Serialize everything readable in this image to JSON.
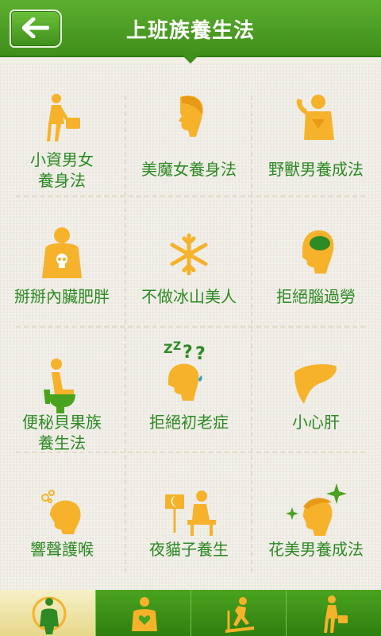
{
  "header": {
    "title": "上班族養生法",
    "back_label": "back"
  },
  "grid": {
    "items": [
      {
        "label": "小資男女\n養身法",
        "icon": "businessman-icon"
      },
      {
        "label": "美魔女養身法",
        "icon": "woman-head-icon"
      },
      {
        "label": "野獸男養成法",
        "icon": "muscle-man-icon"
      },
      {
        "label": "掰掰內臟肥胖",
        "icon": "body-skull-icon"
      },
      {
        "label": "不做冰山美人",
        "icon": "snowflake-icon"
      },
      {
        "label": "拒絕腦過勞",
        "icon": "brain-head-icon"
      },
      {
        "label": "便秘貝果族\n養生法",
        "icon": "toilet-icon"
      },
      {
        "label": "拒絕初老症",
        "icon": "sleepy-head-icon"
      },
      {
        "label": "小心肝",
        "icon": "liver-icon"
      },
      {
        "label": "響聲護喉",
        "icon": "throat-icon"
      },
      {
        "label": "夜貓子養生",
        "icon": "night-desk-icon"
      },
      {
        "label": "花美男養成法",
        "icon": "sparkle-man-icon"
      }
    ]
  },
  "tabs": [
    {
      "icon": "fat-body-icon",
      "active": true
    },
    {
      "icon": "heart-body-icon",
      "active": false
    },
    {
      "icon": "treadmill-icon",
      "active": false
    },
    {
      "icon": "walking-businessman-icon",
      "active": false
    }
  ]
}
